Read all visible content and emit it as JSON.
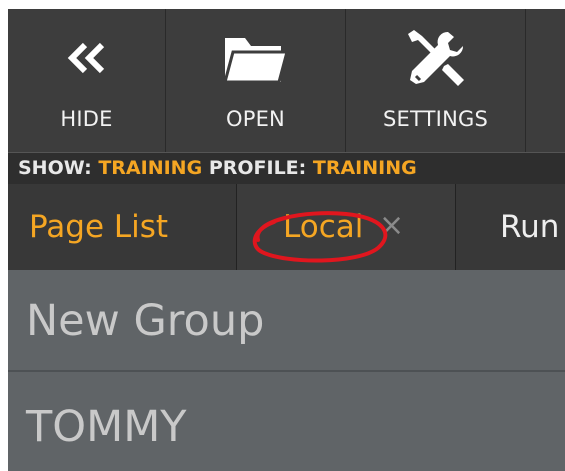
{
  "toolbar": {
    "buttons": [
      {
        "label": "HIDE",
        "icon": "double-chevron-left-icon"
      },
      {
        "label": "OPEN",
        "icon": "folder-icon"
      },
      {
        "label": "SETTINGS",
        "icon": "wrench-screwdriver-icon"
      }
    ]
  },
  "status": {
    "show_label": "SHOW:",
    "show_value": "TRAINING",
    "profile_label": "PROFILE:",
    "profile_value": "TRAINING"
  },
  "tabs": [
    {
      "label": "Page List"
    },
    {
      "label": "Local",
      "close": "×"
    },
    {
      "label": "Run"
    }
  ],
  "groups": [
    {
      "label": "New Group"
    },
    {
      "label": "TOMMY"
    }
  ],
  "colors": {
    "accent": "#f5a623",
    "toolbar_bg": "#3d3d3d",
    "list_bg": "#606467",
    "annotation": "#e0161e"
  }
}
